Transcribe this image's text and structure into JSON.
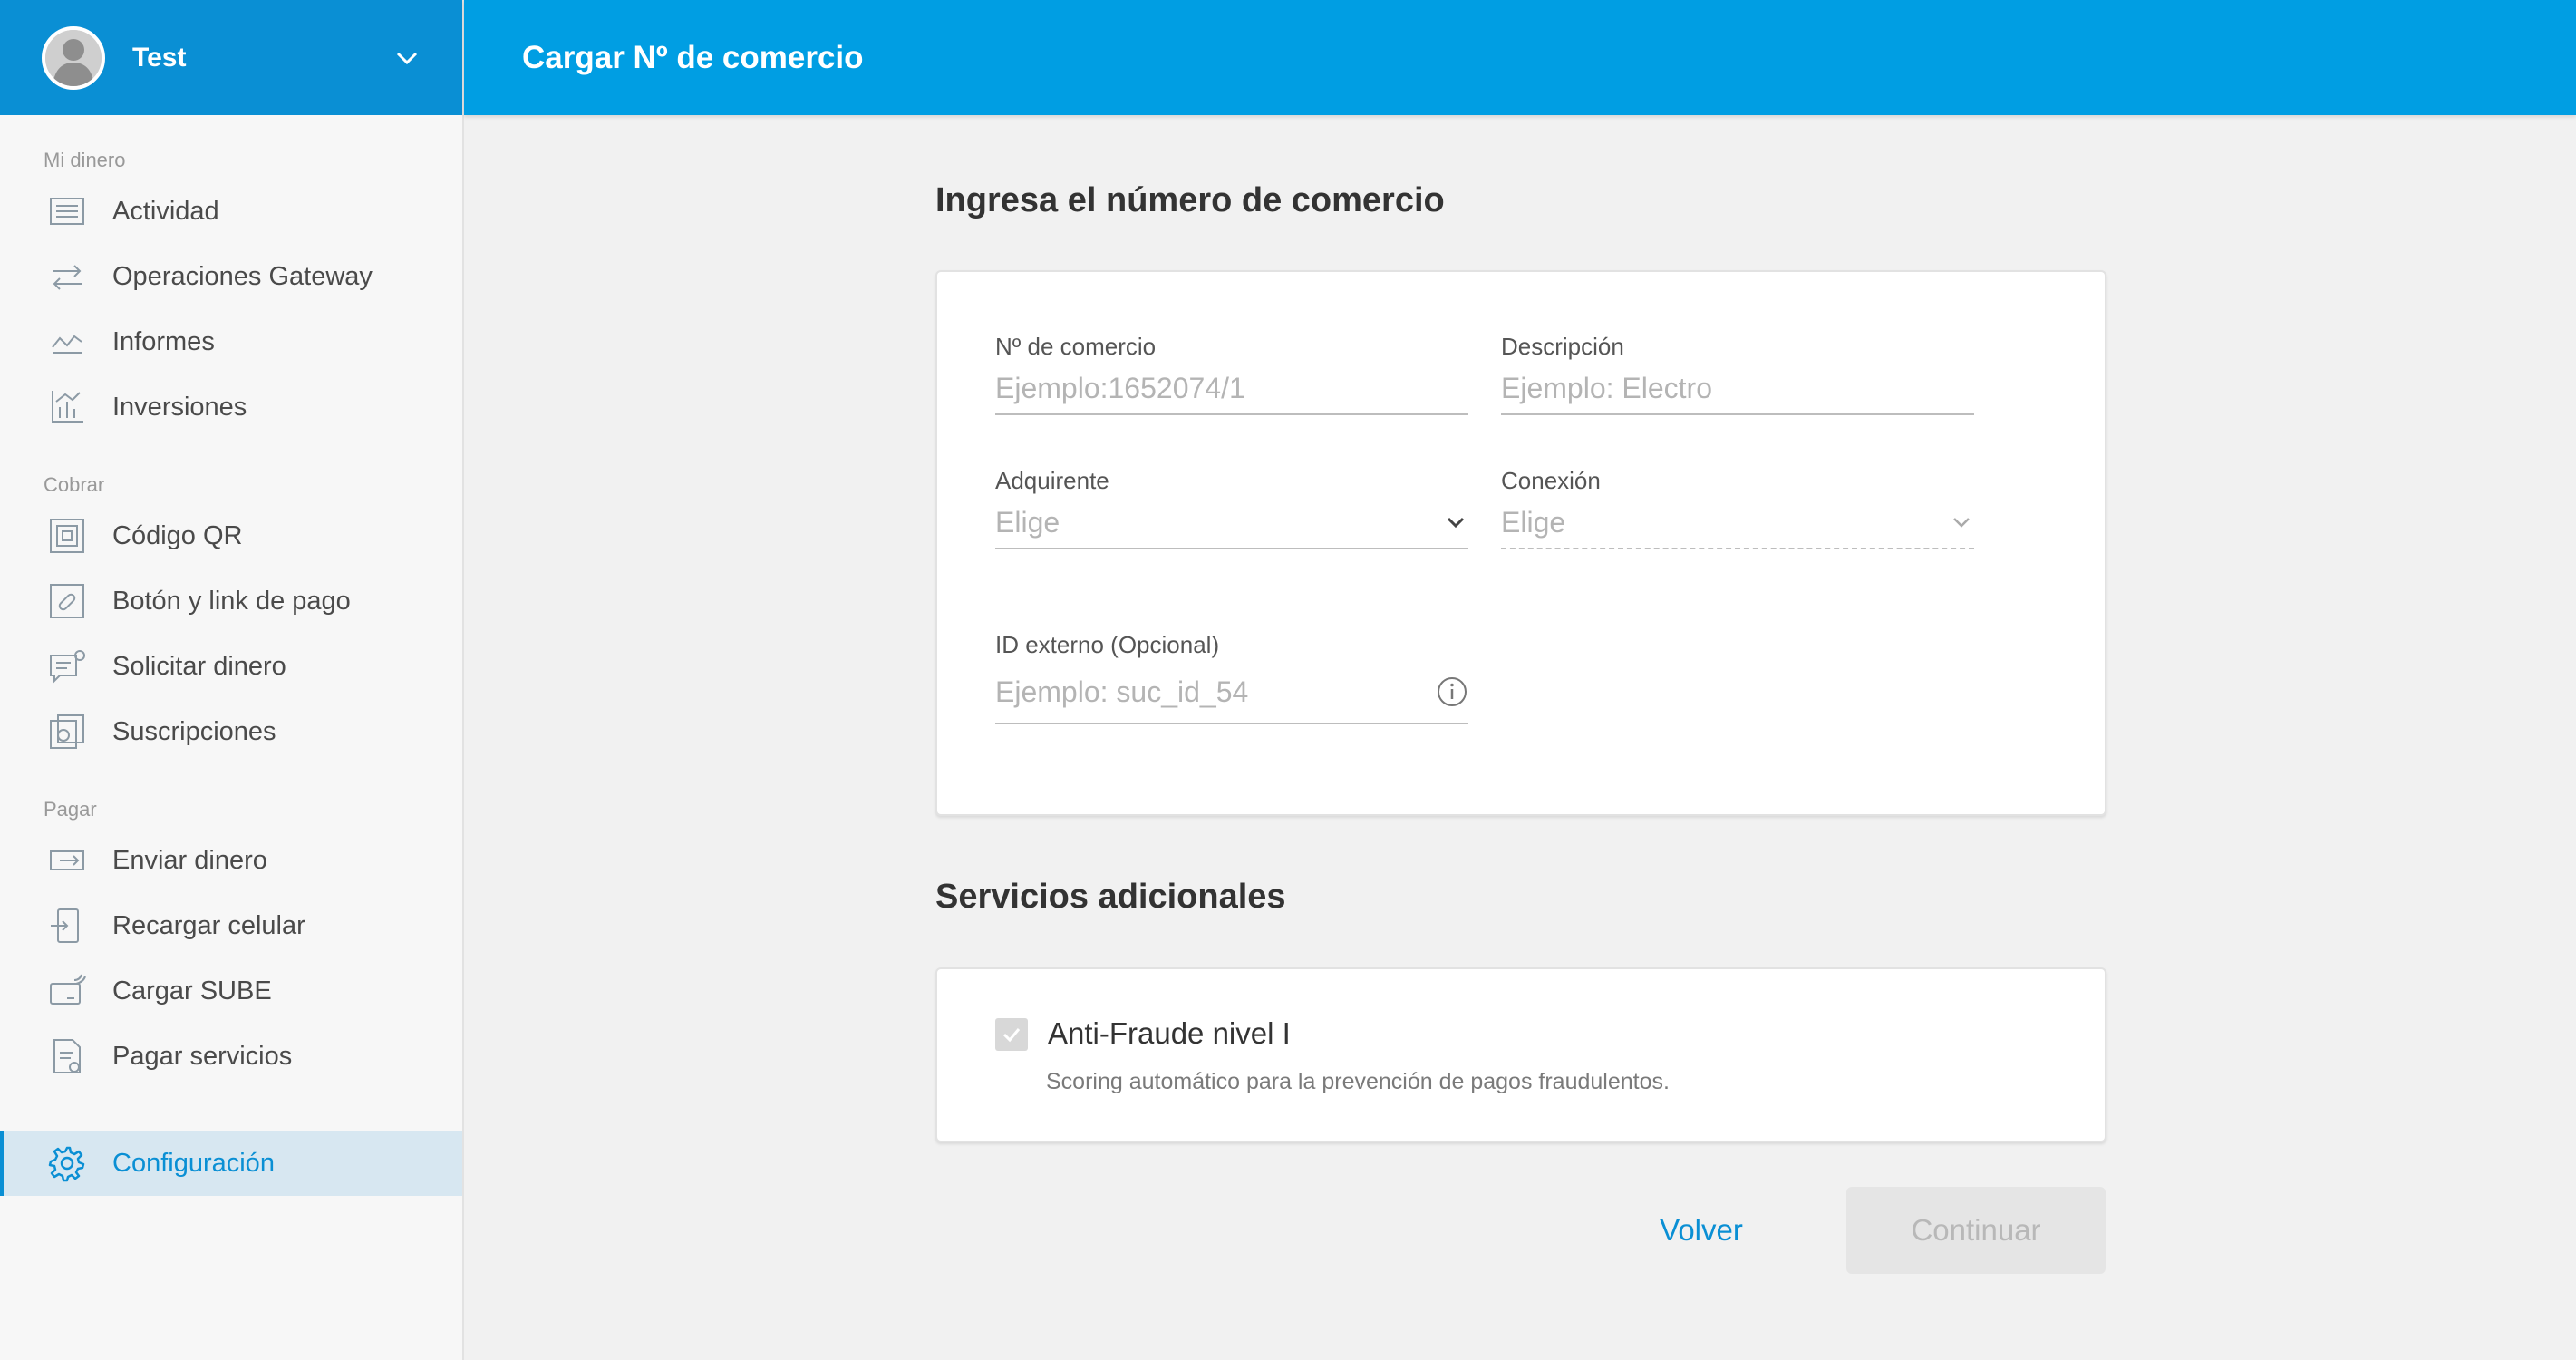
{
  "user": {
    "name": "Test"
  },
  "topbar": {
    "title": "Cargar Nº de comercio"
  },
  "sidebar": {
    "sections": [
      {
        "label": "Mi dinero",
        "items": [
          {
            "label": "Actividad",
            "icon": "list-icon"
          },
          {
            "label": "Operaciones Gateway",
            "icon": "transfer-arrows-icon"
          },
          {
            "label": "Informes",
            "icon": "report-chart-icon"
          },
          {
            "label": "Inversiones",
            "icon": "bar-chart-icon"
          }
        ]
      },
      {
        "label": "Cobrar",
        "items": [
          {
            "label": "Código QR",
            "icon": "qr-code-icon"
          },
          {
            "label": "Botón y link de pago",
            "icon": "link-icon"
          },
          {
            "label": "Solicitar dinero",
            "icon": "request-money-icon"
          },
          {
            "label": "Suscripciones",
            "icon": "subscription-icon"
          }
        ]
      },
      {
        "label": "Pagar",
        "items": [
          {
            "label": "Enviar dinero",
            "icon": "send-money-icon"
          },
          {
            "label": "Recargar celular",
            "icon": "phone-recharge-icon"
          },
          {
            "label": "Cargar SUBE",
            "icon": "sube-card-icon"
          },
          {
            "label": "Pagar servicios",
            "icon": "bill-icon"
          }
        ]
      }
    ],
    "settings": {
      "label": "Configuración",
      "icon": "gear-icon"
    }
  },
  "form": {
    "heading": "Ingresa el número de comercio",
    "merchant_number": {
      "label": "Nº de comercio",
      "placeholder": "Ejemplo:1652074/1"
    },
    "description": {
      "label": "Descripción",
      "placeholder": "Ejemplo: Electro"
    },
    "acquirer": {
      "label": "Adquirente",
      "value": "Elige"
    },
    "connection": {
      "label": "Conexión",
      "value": "Elige"
    },
    "external_id": {
      "label": "ID externo (Opcional)",
      "placeholder": "Ejemplo: suc_id_54"
    }
  },
  "services": {
    "heading": "Servicios adicionales",
    "antifraud": {
      "title": "Anti-Fraude nivel I",
      "description": "Scoring automático para la prevención de pagos fraudulentos.",
      "checked": true
    }
  },
  "actions": {
    "back": "Volver",
    "continue": "Continuar"
  },
  "colors": {
    "primary": "#009ee3",
    "sidebar_header": "#0a8fd4",
    "active_bg": "#d7e7f1"
  }
}
